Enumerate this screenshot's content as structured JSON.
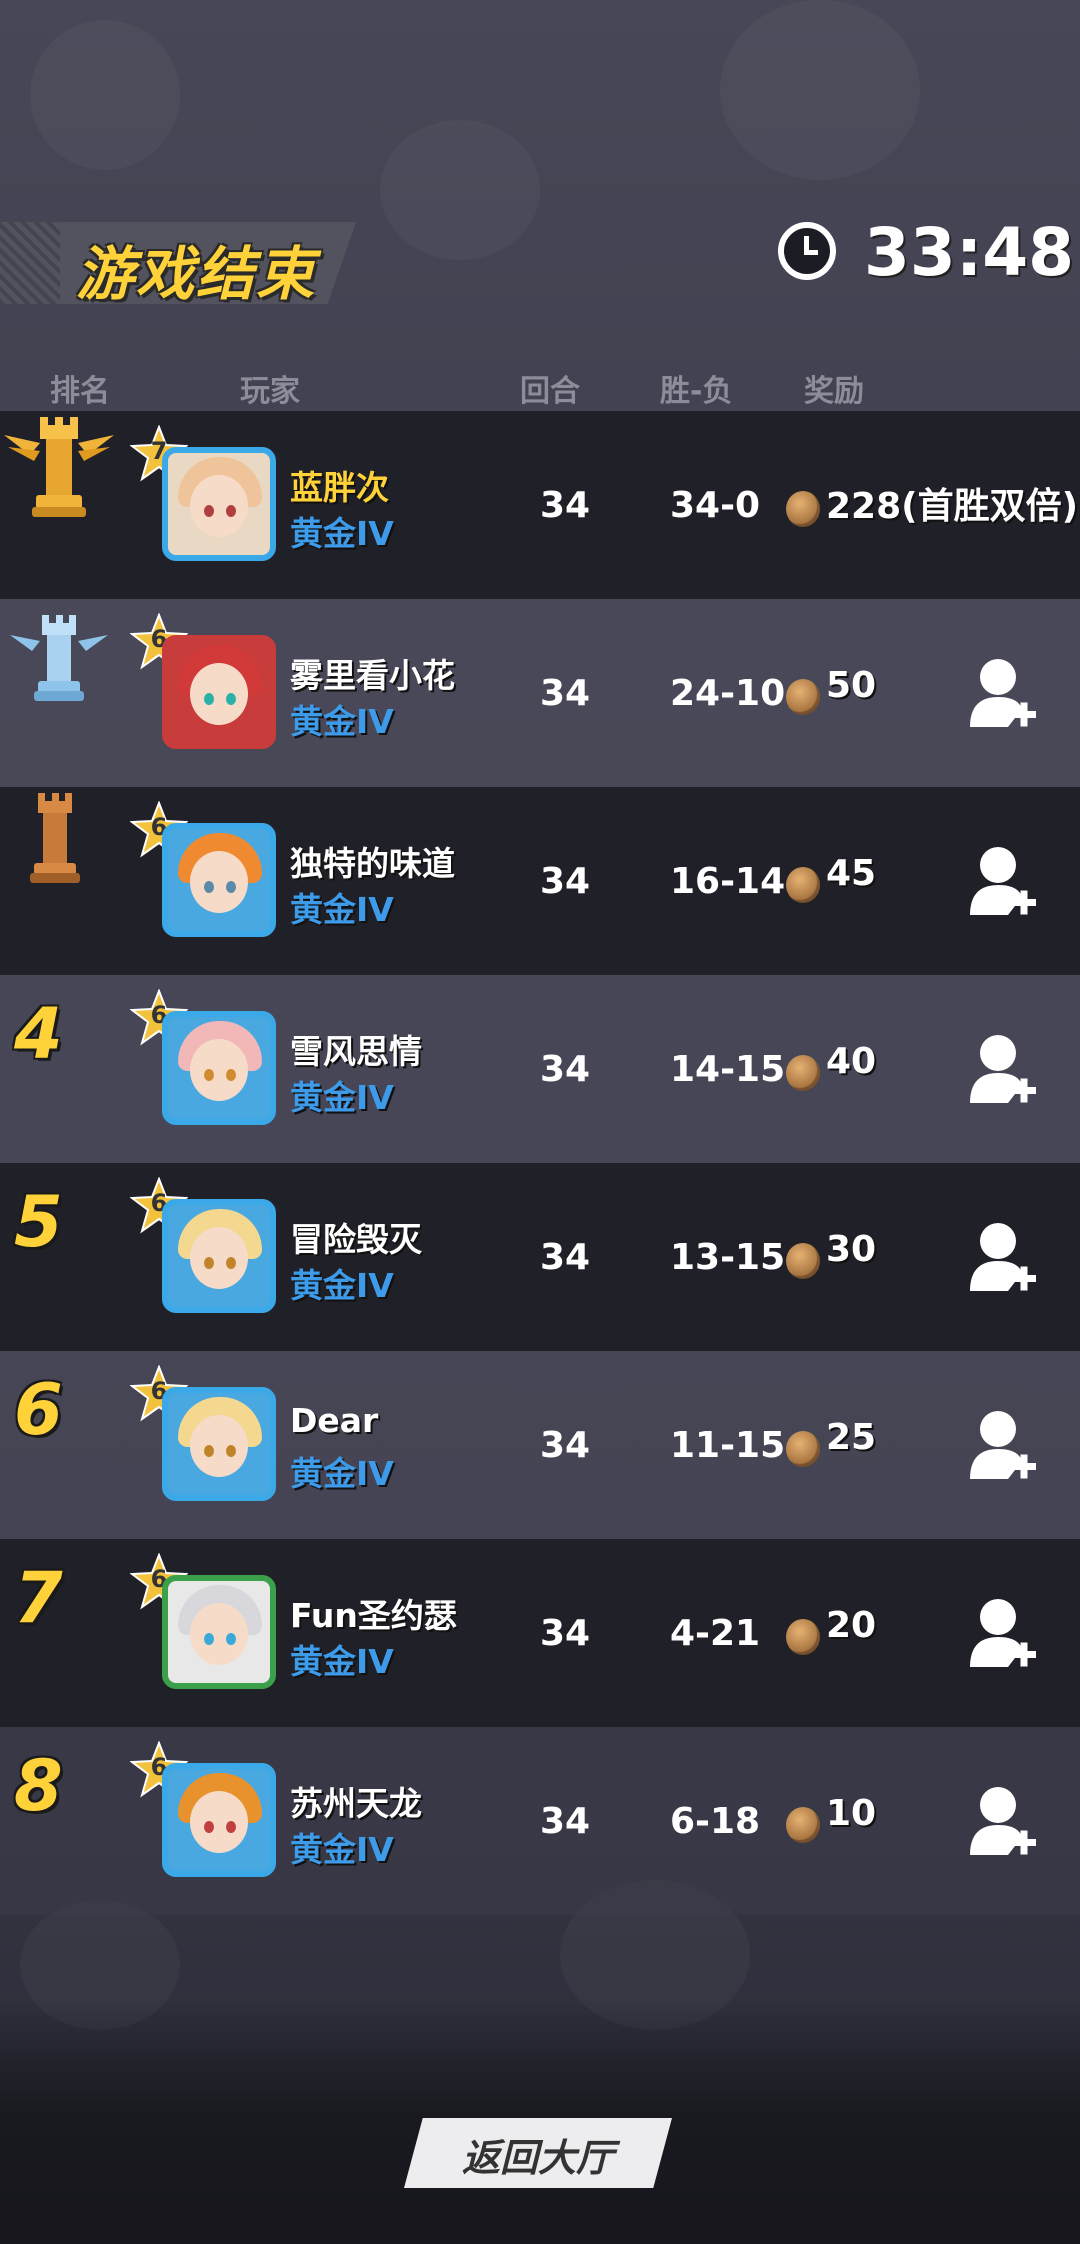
{
  "header": {
    "title": "游戏结束",
    "timer": "33:48"
  },
  "columns": {
    "rank": "排名",
    "player": "玩家",
    "rounds": "回合",
    "record": "胜-负",
    "reward": "奖励"
  },
  "rows": [
    {
      "rank": "1",
      "rank_icon": "gold-rook-trophy-icon",
      "level": "7",
      "name": "蓝胖次",
      "tier": "黄金IV",
      "rounds": "34",
      "record": "34-0",
      "reward": "228(首胜双倍)",
      "add_friend": false
    },
    {
      "rank": "2",
      "rank_icon": "silver-rook-trophy-icon",
      "level": "6",
      "name": "雾里看小花",
      "tier": "黄金IV",
      "rounds": "34",
      "record": "24-10",
      "reward": "50",
      "add_friend": true
    },
    {
      "rank": "3",
      "rank_icon": "bronze-rook-icon",
      "level": "6",
      "name": "独特的味道",
      "tier": "黄金IV",
      "rounds": "34",
      "record": "16-14",
      "reward": "45",
      "add_friend": true
    },
    {
      "rank": "4",
      "level": "6",
      "name": "雪风思情",
      "tier": "黄金IV",
      "rounds": "34",
      "record": "14-15",
      "reward": "40",
      "add_friend": true
    },
    {
      "rank": "5",
      "level": "6",
      "name": "冒险毁灭",
      "tier": "黄金IV",
      "rounds": "34",
      "record": "13-15",
      "reward": "30",
      "add_friend": true
    },
    {
      "rank": "6",
      "level": "6",
      "name": "Dear",
      "tier": "黄金IV",
      "rounds": "34",
      "record": "11-15",
      "reward": "25",
      "add_friend": true
    },
    {
      "rank": "7",
      "level": "6",
      "name": "Fun圣约瑟",
      "tier": "黄金IV",
      "rounds": "34",
      "record": "4-21",
      "reward": "20",
      "add_friend": true
    },
    {
      "rank": "8",
      "level": "6",
      "name": "苏州天龙",
      "tier": "黄金IV",
      "rounds": "34",
      "record": "6-18",
      "reward": "10",
      "add_friend": true
    }
  ],
  "footer": {
    "return_button": "返回大厅"
  },
  "colors": {
    "title": "#ffd23a",
    "tier": "#3d9bea",
    "gold": "#f0b43a",
    "silver": "#8fc4ea",
    "bronze": "#c77a3a"
  }
}
